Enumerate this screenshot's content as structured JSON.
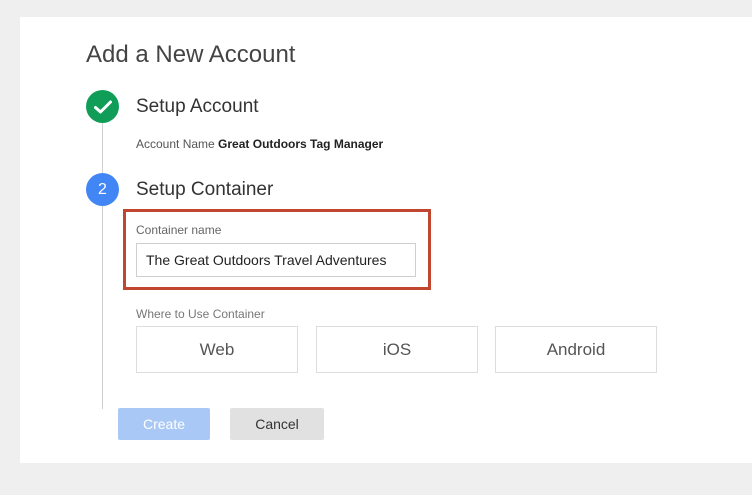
{
  "page": {
    "title": "Add a New Account"
  },
  "steps": [
    {
      "number": "",
      "title": "Setup Account",
      "state": "complete"
    },
    {
      "number": "2",
      "title": "Setup Container",
      "state": "active"
    }
  ],
  "account": {
    "label": "Account Name",
    "value": "Great Outdoors Tag Manager"
  },
  "container": {
    "label": "Container name",
    "value": "The Great Outdoors Travel Adventures",
    "highlight_color": "#c0462f"
  },
  "where": {
    "label": "Where to Use Container",
    "options": [
      "Web",
      "iOS",
      "Android"
    ]
  },
  "buttons": {
    "create": "Create",
    "cancel": "Cancel"
  },
  "colors": {
    "complete": "#0f9d58",
    "active": "#4285f4",
    "create_disabled": "#a9c8f5"
  }
}
